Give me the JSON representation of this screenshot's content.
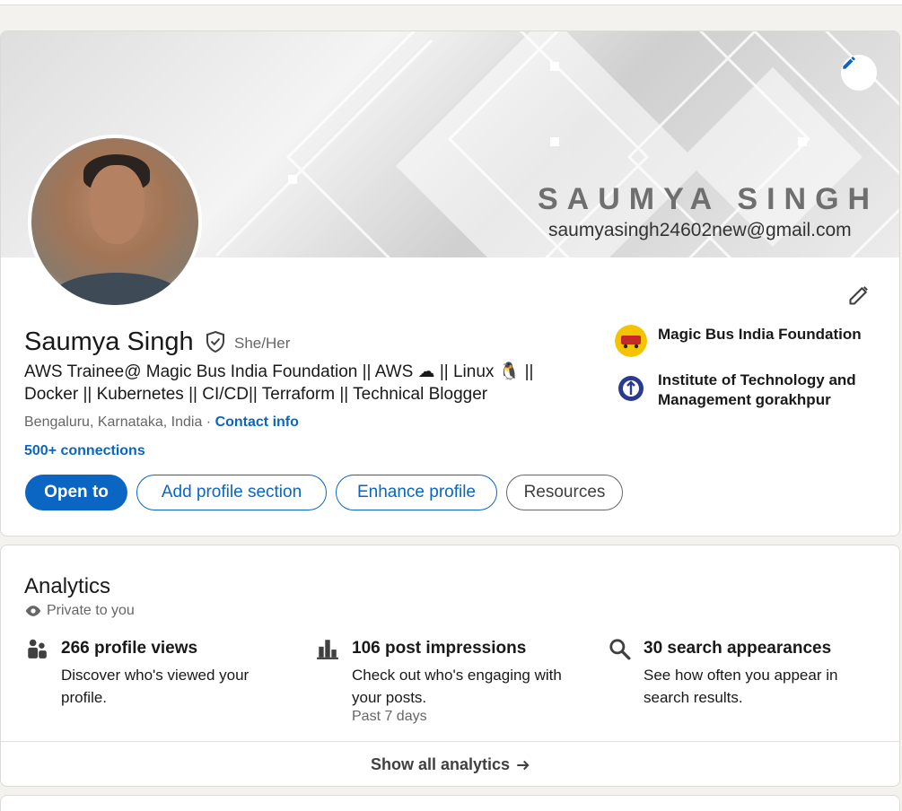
{
  "banner": {
    "name_text": "SAUMYA SINGH",
    "email_text": "saumyasingh24602new@gmail.com"
  },
  "profile": {
    "name": "Saumya Singh",
    "pronouns": "She/Her",
    "headline_line1": "AWS Trainee@ Magic Bus India Foundation || AWS ☁ || Linux 🐧 ||",
    "headline_line2": "Docker || Kubernetes || CI/CD|| Terraform || Technical Blogger",
    "location": "Bengaluru, Karnataka, India · ",
    "contact_info": "Contact info",
    "connections": "500+ connections"
  },
  "buttons": {
    "open_to": "Open to",
    "add_section": "Add profile section",
    "enhance": "Enhance profile",
    "resources": "Resources"
  },
  "orgs": [
    {
      "name": "Magic Bus India Foundation",
      "logo_color": "#f5c400"
    },
    {
      "name": "Institute of Technology and Management gorakhpur",
      "logo_color": "#2b3a8f"
    }
  ],
  "analytics": {
    "title": "Analytics",
    "privacy": "Private to you",
    "metrics": [
      {
        "icon": "people-icon",
        "title": "266 profile views",
        "desc": "Discover who's viewed your profile.",
        "sub": ""
      },
      {
        "icon": "bar-chart-icon",
        "title": "106 post impressions",
        "desc": "Check out who's engaging with your posts.",
        "sub": "Past 7 days"
      },
      {
        "icon": "search-icon",
        "title": "30 search appearances",
        "desc": "See how often you appear in search results.",
        "sub": ""
      }
    ],
    "footer": "Show all analytics"
  },
  "colors": {
    "accent": "#0a66c2",
    "background": "#f4f2ee"
  }
}
